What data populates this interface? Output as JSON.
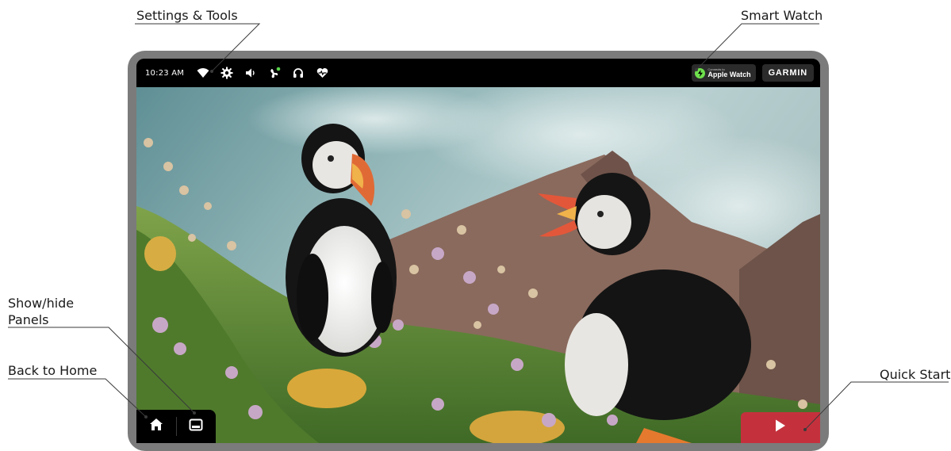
{
  "callouts": {
    "settings_tools": "Settings & Tools",
    "smart_watch": "Smart Watch",
    "show_hide_panels_line1": "Show/hide",
    "show_hide_panels_line2": "Panels",
    "back_to_home": "Back to Home",
    "quick_start": "Quick Start"
  },
  "status_bar": {
    "time": "10:23 AM",
    "icons": [
      "wifi-icon",
      "settings-icon",
      "volume-icon",
      "fan-icon",
      "headphones-icon",
      "heart-rate-icon"
    ],
    "apple_watch_small": "Connects to",
    "apple_watch_label": "Apple Watch",
    "garmin_label": "GARMIN"
  },
  "bottom_controls": {
    "home_icon": "home-icon",
    "panels_icon": "panels-toggle-icon",
    "quick_start_icon": "play-icon"
  },
  "colors": {
    "device_bezel": "#7b7b7b",
    "quick_start": "#c4313d",
    "apple_watch_green": "#6ee04c"
  }
}
